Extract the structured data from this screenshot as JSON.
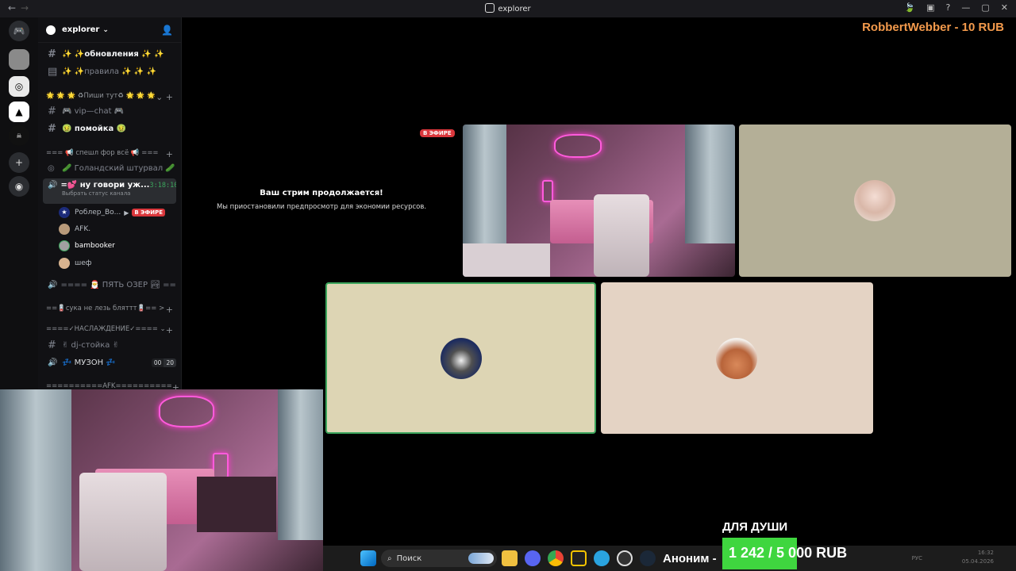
{
  "titlebar": {
    "title": "explorer",
    "back": "←",
    "forward": "→"
  },
  "server": {
    "name": "explorer"
  },
  "channels": [
    {
      "id": "updates",
      "label": "✨ ✨обновления ✨ ✨"
    },
    {
      "id": "rules",
      "label": "✨ ✨правила ✨ ✨ ✨"
    },
    {
      "id": "cat-write",
      "label": "🌟 🌟 🌟 ♻Пиши тут♻ 🌟 🌟 🌟"
    },
    {
      "id": "vip",
      "label": "🎮 vip—chat 🎮"
    },
    {
      "id": "trash",
      "label": "🤢 помойка 🤢"
    },
    {
      "id": "cat-special",
      "label": "=== 📢 спешл фор всё 📢 ==="
    },
    {
      "id": "dutch",
      "label": "🥒 Голандский штурвал 🥒"
    },
    {
      "id": "voice-active",
      "label": "=💕 ну говори уж...",
      "timer": "3:18:10",
      "status": "Выбрать статус канала"
    },
    {
      "id": "five-lakes",
      "label": "==== 🎅 ПЯТЬ ОЗЕР 🏞 ===="
    },
    {
      "id": "cat-suka",
      "label": "==🪫сука не лезь бляттт🪫== >"
    },
    {
      "id": "cat-pleasure",
      "label": "====✓НАСЛАЖДЕНИЕ✓==== ⌄"
    },
    {
      "id": "dj",
      "label": "✌ dj-стойка ✌"
    },
    {
      "id": "music",
      "label": "💤 МУЗОН 💤",
      "count_a": "00",
      "count_b": "20"
    },
    {
      "id": "cat-afk",
      "label": "==========AFK=========="
    }
  ],
  "voice_users": [
    {
      "name": "Роблер_Во...",
      "live": "В ЭФИРЕ"
    },
    {
      "name": "AFK."
    },
    {
      "name": "bambooker"
    },
    {
      "name": "шеф"
    }
  ],
  "stream": {
    "live_badge": "В ЭФИРЕ",
    "title": "Ваш стрим продолжается!",
    "subtitle": "Мы приостановили предпросмотр для экономии ресурсов."
  },
  "overlay": {
    "donation": "RobbertWebber - 10 RUB",
    "goal_title": "ДЛЯ ДУШИ",
    "goal_text": "1 242 / 5 000 RUB",
    "goal_fraction": 0.2484,
    "ticker": "Аноним -"
  },
  "taskbar": {
    "search_placeholder": "Поиск",
    "lang": "РУС",
    "time": "16:32",
    "date": "05.04.2026"
  },
  "colors": {
    "accent_live": "#da373c",
    "donation": "#f39a4c",
    "goal_fill": "#3fd63f",
    "speaking_border": "#3ba55c"
  }
}
